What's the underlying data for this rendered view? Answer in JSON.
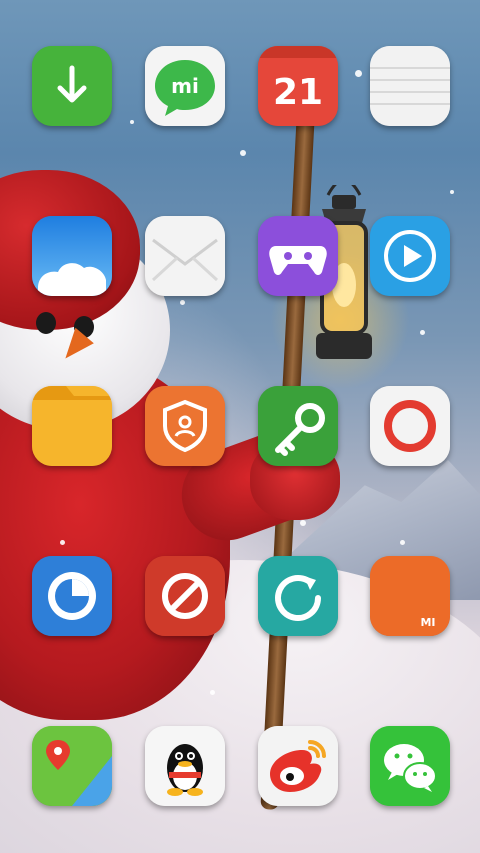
{
  "screen": {
    "name": "home-screen"
  },
  "calendar_day": "21",
  "apps": [
    {
      "name": "app-downloads",
      "icon": "download-arrow-icon",
      "color": "#44b03a"
    },
    {
      "name": "app-mitalk",
      "icon": "mi-chat-bubble-icon",
      "color": "#3db84a",
      "label": "mi"
    },
    {
      "name": "app-calendar",
      "icon": "calendar-icon",
      "color": "#e5473a"
    },
    {
      "name": "app-notes",
      "icon": "notes-icon",
      "color": "#f2f2f2"
    },
    {
      "name": "app-weather",
      "icon": "cloud-icon",
      "color": "#2f8fe6"
    },
    {
      "name": "app-email",
      "icon": "envelope-icon",
      "color": "#f3f3f3"
    },
    {
      "name": "app-game-center",
      "icon": "gamepad-icon",
      "color": "#8c4fdb"
    },
    {
      "name": "app-video",
      "icon": "play-icon",
      "color": "#2aa0e4"
    },
    {
      "name": "app-file-manager",
      "icon": "folder-icon",
      "color": "#f4a81e"
    },
    {
      "name": "app-security",
      "icon": "shield-user-icon",
      "color": "#ec7431"
    },
    {
      "name": "app-unlock",
      "icon": "key-icon",
      "color": "#3aa13a"
    },
    {
      "name": "app-recorder",
      "icon": "record-ring-icon",
      "color": "#f3f3f3"
    },
    {
      "name": "app-cleaner",
      "icon": "clock-ring-icon",
      "color": "#2e7fd8"
    },
    {
      "name": "app-block",
      "icon": "prohibit-icon",
      "color": "#cf3a2a"
    },
    {
      "name": "app-update",
      "icon": "refresh-icon",
      "color": "#26a8a2"
    },
    {
      "name": "app-mi-store",
      "icon": "mi-logo-icon",
      "color": "#ec6b28",
      "label": "MI"
    },
    {
      "name": "app-maps",
      "icon": "map-pin-icon",
      "color": "#5bbf3a"
    },
    {
      "name": "app-qq",
      "icon": "penguin-icon",
      "color": "#f6f6f6"
    },
    {
      "name": "app-weibo",
      "icon": "weibo-eye-icon",
      "color": "#f3f3f3"
    },
    {
      "name": "app-wechat",
      "icon": "wechat-bubbles-icon",
      "color": "#35c23a"
    }
  ]
}
